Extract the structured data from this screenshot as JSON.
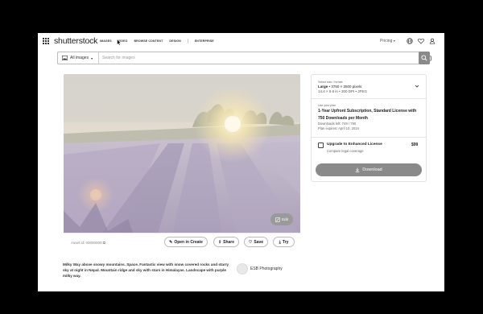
{
  "header": {
    "logo": "shutterstock",
    "nav": [
      "IMAGES",
      "VIDEO",
      "BROWSE CONTENT",
      "DESIGN",
      "ENTERPRISE"
    ],
    "pricing": "Pricing"
  },
  "search": {
    "filter_label": "All images",
    "placeholder": "Search for images",
    "value": ""
  },
  "asset": {
    "id_label": "Asset id: 00000000",
    "edit_label": "Edit",
    "actions": {
      "open_in_create": "Open in Create",
      "share": "Share",
      "save": "Save",
      "try": "Try"
    }
  },
  "license": {
    "size_label": "Select size / format",
    "size_name": "Large",
    "size_pixels": "• 3750 × 2500 pixels",
    "size_dims": "14.4 × 9.6 in • 300 DPI • JPEG",
    "plan_label": "Use your plan",
    "plan_title": "1-Year Upfront Subscription, Standard License with 750 Downloads per Month",
    "downloads_left": "Downloads left: 749 / 750",
    "plan_expires": "Plan expires: April 10, 2024",
    "upgrade_label": "Upgrade to Enhanced License",
    "upgrade_sub": "Compare legal coverage",
    "upgrade_price": "$99",
    "download_label": "Download"
  },
  "description": "Milky Way above snowy mountains. Space. Fantastic view with snow covered rocks and starry sky at night in Nepal. Mountain ridge and sky with stars in Himalayas. Landscape with purple milky way.",
  "contributor": "ESB Photography",
  "colors": {
    "button_gray": "#8a8a8a",
    "border": "#e3e3e3",
    "text": "#222222"
  }
}
